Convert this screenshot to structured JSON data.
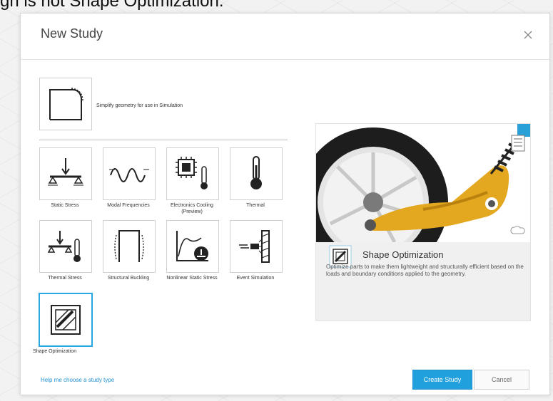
{
  "page": {
    "top_text": "gn is not Shape Optimization."
  },
  "dialog": {
    "title": "New Study",
    "close_icon": "close-icon",
    "simplify": {
      "label": "Simplify geometry for use in Simulation",
      "icon": "simplify-icon"
    },
    "study_types": [
      {
        "label": "Static Stress",
        "icon": "static-stress-icon"
      },
      {
        "label": "Modal Frequencies",
        "icon": "modal-frequencies-icon"
      },
      {
        "label": "Electronics Cooling (Preview)",
        "icon": "electronics-cooling-icon"
      },
      {
        "label": "Thermal",
        "icon": "thermal-icon"
      },
      {
        "label": "Thermal Stress",
        "icon": "thermal-stress-icon"
      },
      {
        "label": "Structural Buckling",
        "icon": "structural-buckling-icon"
      },
      {
        "label": "Nonlinear Static Stress",
        "icon": "nonlinear-static-stress-icon"
      },
      {
        "label": "Event Simulation",
        "icon": "event-simulation-icon"
      },
      {
        "label": "Shape Optimization",
        "icon": "shape-optimization-icon",
        "selected": true
      }
    ],
    "preview": {
      "title": "Shape Optimization",
      "description": "Optimize parts to make them lightweight and structurally efficient based on the loads and boundary conditions applied to the geometry.",
      "image": "suspension-arm-render"
    },
    "help_link": "Help me choose a study type",
    "create_button": "Create Study",
    "cancel_button": "Cancel",
    "accent_color": "#20a0dc"
  }
}
